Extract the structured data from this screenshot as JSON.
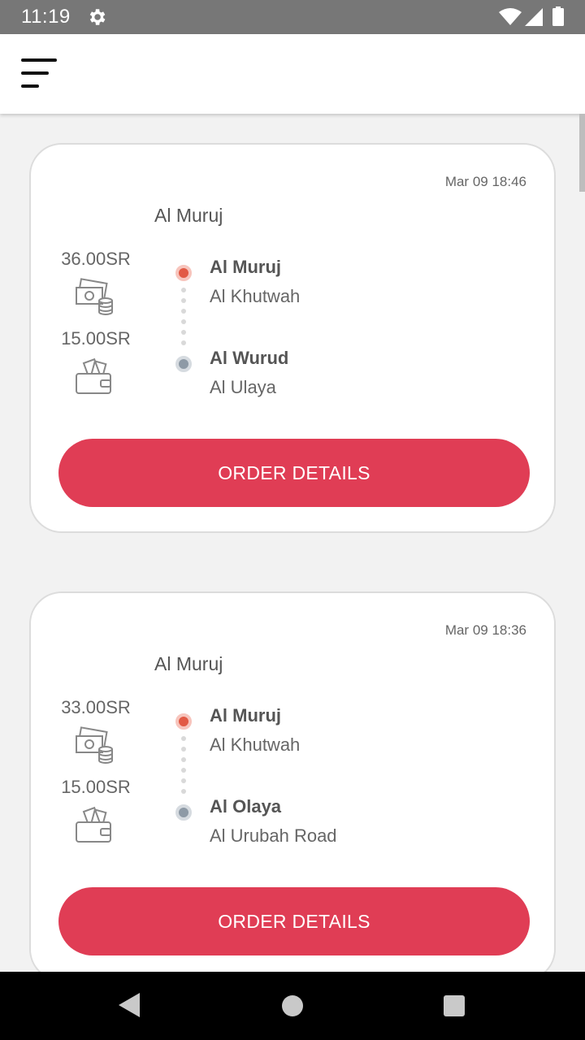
{
  "status_bar": {
    "time": "11:19",
    "icons": [
      "gear-icon",
      "wifi-icon",
      "signal-icon",
      "battery-icon"
    ]
  },
  "app_bar": {
    "menu_icon": "menu-icon"
  },
  "orders": [
    {
      "date": "Mar 09 18:46",
      "title": "Al Muruj",
      "price_trip": "36.00SR",
      "price_wallet": "15.00SR",
      "origin_main": "Al Muruj",
      "origin_sub": "Al Khutwah",
      "dest_main": "Al Wurud",
      "dest_sub": "Al Ulaya",
      "button_label": "ORDER DETAILS"
    },
    {
      "date": "Mar 09 18:36",
      "title": "Al Muruj",
      "price_trip": "33.00SR",
      "price_wallet": "15.00SR",
      "origin_main": "Al Muruj",
      "origin_sub": "Al Khutwah",
      "dest_main": "Al Olaya",
      "dest_sub": "Al Urubah Road",
      "button_label": "ORDER DETAILS"
    }
  ],
  "colors": {
    "accent": "#e03d55",
    "origin_dot": "#e25a45",
    "dest_dot": "#8e9aa6",
    "status_bar": "#777777"
  },
  "nav_bar": {
    "icons": [
      "back-icon",
      "home-icon",
      "recent-apps-icon"
    ]
  }
}
